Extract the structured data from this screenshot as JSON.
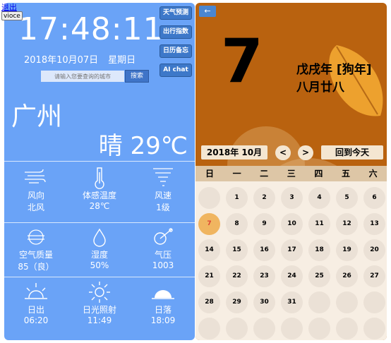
{
  "links": {
    "logout": "退出",
    "voice": "vioce"
  },
  "clock": {
    "time": "17:48:11",
    "date": "2018年10月07日",
    "weekday": "星期日"
  },
  "search": {
    "placeholder": "请输入您要查询的城市",
    "button": "搜索"
  },
  "side_buttons": [
    "天气预测",
    "出行指数",
    "日历备忘",
    "AI chat"
  ],
  "location": {
    "city": "广州",
    "weather": "晴 29℃"
  },
  "metrics": [
    {
      "icon": "wind-icon",
      "label": "风向",
      "value": "北风"
    },
    {
      "icon": "thermometer-icon",
      "label": "体感温度",
      "value": "28℃"
    },
    {
      "icon": "tornado-icon",
      "label": "风速",
      "value": "1级"
    },
    {
      "icon": "air-quality-icon",
      "label": "空气质量",
      "value": "85（良）"
    },
    {
      "icon": "droplet-icon",
      "label": "湿度",
      "value": "50%"
    },
    {
      "icon": "pressure-icon",
      "label": "气压",
      "value": "1003"
    },
    {
      "icon": "sunrise-icon",
      "label": "日出",
      "value": "06:20"
    },
    {
      "icon": "sun-icon",
      "label": "日光照射",
      "value": "11:49"
    },
    {
      "icon": "sunset-icon",
      "label": "日落",
      "value": "18:09"
    }
  ],
  "calendar": {
    "back": "←",
    "day": "7",
    "lunar_year": "戊戌年 [狗年]",
    "lunar_date": "八月廿八",
    "year_month": "2018年 10月",
    "prev": "<",
    "next": ">",
    "today_button": "回到今天",
    "weekdays": [
      "日",
      "一",
      "二",
      "三",
      "四",
      "五",
      "六"
    ],
    "days": [
      "",
      "1",
      "2",
      "3",
      "4",
      "5",
      "6",
      "7",
      "8",
      "9",
      "10",
      "11",
      "12",
      "13",
      "14",
      "15",
      "16",
      "17",
      "18",
      "19",
      "20",
      "21",
      "22",
      "23",
      "24",
      "25",
      "26",
      "27",
      "28",
      "29",
      "30",
      "31",
      "",
      "",
      "",
      "",
      "",
      "",
      "",
      "",
      "",
      ""
    ],
    "today_day": "7"
  },
  "colors": {
    "left_bg": "#6aa3f7",
    "right_bg": "#b9620f",
    "button_blue": "#3d78c9",
    "today_circle": "#f0b560"
  }
}
